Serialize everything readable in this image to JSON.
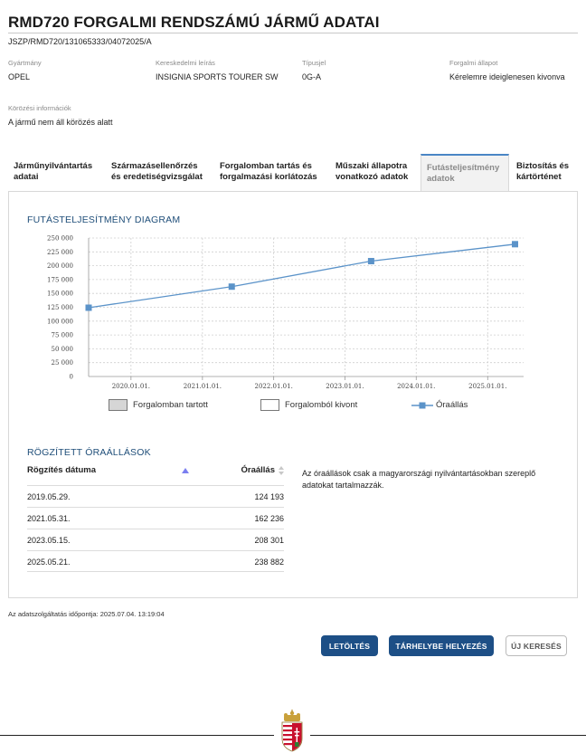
{
  "header": {
    "title": "RMD720 FORGALMI RENDSZÁMÚ JÁRMŰ ADATAI",
    "reference": "JSZP/RMD720/131065333/04072025/A"
  },
  "vehicle": {
    "make_label": "Gyártmány",
    "make_value": "OPEL",
    "commercial_label": "Kereskedelmi leírás",
    "commercial_value": "INSIGNIA SPORTS TOURER SW",
    "type_label": "Típusjel",
    "type_value": "0G-A",
    "status_label": "Forgalmi állapot",
    "status_value": "Kérelemre ideiglenesen kivonva",
    "wanted_label": "Körözési információk",
    "wanted_value": "A jármű nem áll körözés alatt"
  },
  "tabs": [
    {
      "line1": "Járműnyilvántartás",
      "line2": "adatai"
    },
    {
      "line1": "Származásellenőrzés",
      "line2": "és eredetiségvizsgálat"
    },
    {
      "line1": "Forgalomban tartás és",
      "line2": "forgalmazási korlátozás"
    },
    {
      "line1": "Műszaki állapotra",
      "line2": "vonatkozó adatok"
    },
    {
      "line1": "Futásteljesítmény",
      "line2": "adatok"
    },
    {
      "line1": "Biztosítás és",
      "line2": "kártörténet"
    }
  ],
  "active_tab_index": 4,
  "diagram": {
    "title": "FUTÁSTELJESÍTMÉNY DIAGRAM"
  },
  "chart_data": {
    "type": "line",
    "x_ticks": [
      "2020.01.01.",
      "2021.01.01.",
      "2022.01.01.",
      "2023.01.01.",
      "2024.01.01.",
      "2025.01.01."
    ],
    "y_ticks": [
      "0",
      "25 000",
      "50 000",
      "75 000",
      "100 000",
      "125 000",
      "150 000",
      "175 000",
      "200 000",
      "225 000",
      "250 000"
    ],
    "ylim": [
      0,
      250000
    ],
    "xlim": [
      "2019.05.29.",
      "2025.07.04."
    ],
    "grid": true,
    "legend_position": "bottom",
    "legend": [
      {
        "name": "Forgalomban tartott",
        "style": "box",
        "color": "#d6d6d6"
      },
      {
        "name": "Forgalomból kivont",
        "style": "box",
        "color": "#ffffff"
      },
      {
        "name": "Óraállás",
        "style": "line-marker",
        "color": "#5b93c9"
      }
    ],
    "series": [
      {
        "name": "Óraállás",
        "points": [
          {
            "x": "2019.05.29.",
            "y": 124193
          },
          {
            "x": "2021.05.31.",
            "y": 162236
          },
          {
            "x": "2023.05.15.",
            "y": 208301
          },
          {
            "x": "2025.05.21.",
            "y": 238882
          }
        ]
      }
    ]
  },
  "records": {
    "title": "RÖGZÍTETT ÓRAÁLLÁSOK",
    "col_date": "Rögzítés dátuma",
    "col_odometer": "Óraállás",
    "rows": [
      {
        "date": "2019.05.29.",
        "value": "124 193"
      },
      {
        "date": "2021.05.31.",
        "value": "162 236"
      },
      {
        "date": "2023.05.15.",
        "value": "208 301"
      },
      {
        "date": "2025.05.21.",
        "value": "238 882"
      }
    ],
    "note": "Az óraállások csak a magyarországi nyilvántartásokban szereplő adatokat tartalmazzák."
  },
  "service_time": "Az adatszolgáltatás időpontja: 2025.07.04. 13:19:04",
  "buttons": {
    "download": "LETÖLTÉS",
    "store": "TÁRHELYBE HELYEZÉS",
    "new_search": "ÚJ KERESÉS"
  },
  "colors": {
    "accent": "#1d4f86",
    "series": "#5b93c9",
    "section_title": "#1f4e79"
  }
}
